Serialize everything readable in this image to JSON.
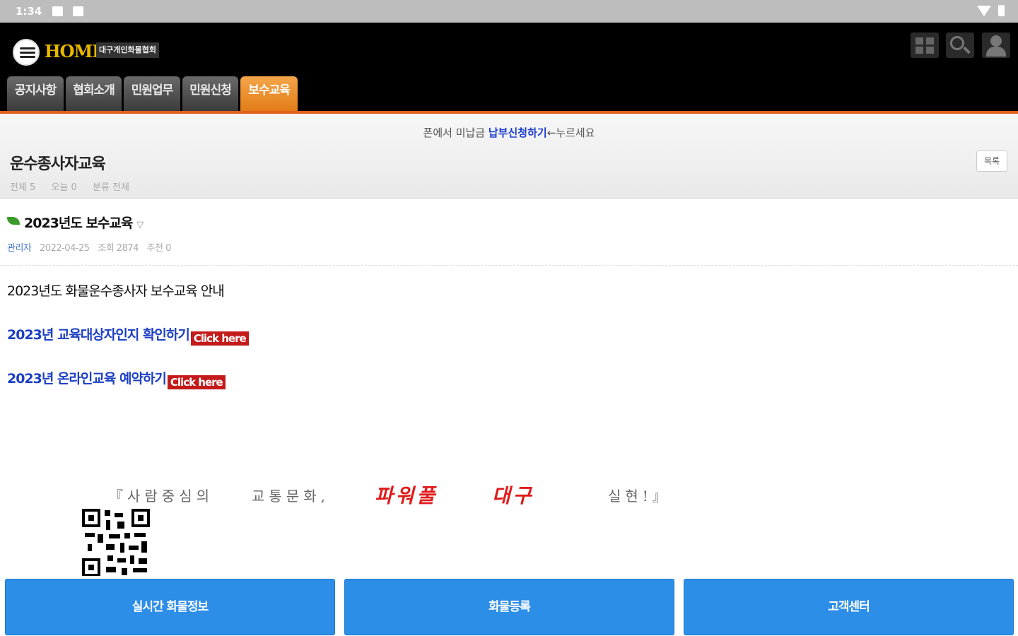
{
  "status_bar": {
    "time": "1:34"
  },
  "header": {
    "logo_text": "HOME",
    "logo_sub": "대구개인화물협회",
    "icons": [
      "grid-icon",
      "search-icon",
      "user-icon"
    ]
  },
  "tabs": [
    {
      "label": "공지사항",
      "active": false
    },
    {
      "label": "협회소개",
      "active": false
    },
    {
      "label": "민원업무",
      "active": false
    },
    {
      "label": "민원신청",
      "active": false
    },
    {
      "label": "보수교육",
      "active": true
    }
  ],
  "notice": {
    "prefix": "폰에서 미납금 ",
    "highlight": "납부신청하기",
    "suffix": "←누르세요"
  },
  "board": {
    "title": "운수종사자교육",
    "stats": {
      "total": "전체 5",
      "today": "오늘 0",
      "category": "분류 전체"
    },
    "list_button": "목록"
  },
  "post": {
    "title": "2023년도 보수교육",
    "author": "관리자",
    "date": "2022-04-25",
    "views": "조회 2874",
    "likes": "추천 0"
  },
  "content": {
    "intro": "2023년도 화물운수종사자 보수교육 안내",
    "link1": "2023년 교육대상자인지 확인하기",
    "link2": "2023년 온라인교육 예약하기",
    "click_here": "Click here",
    "slogan": {
      "part1": "『사람중심의",
      "part2": "교통문화,",
      "red1": "파워풀",
      "red2": "대구",
      "part3": "실현!』"
    }
  },
  "bottom_nav": [
    "실시간 화물정보",
    "화물등록",
    "고객센터"
  ],
  "colors": {
    "accent_orange": "#e27b17",
    "button_blue": "#2d8ee8",
    "link_blue": "#1c3fc4",
    "click_red": "#c41a1a"
  }
}
